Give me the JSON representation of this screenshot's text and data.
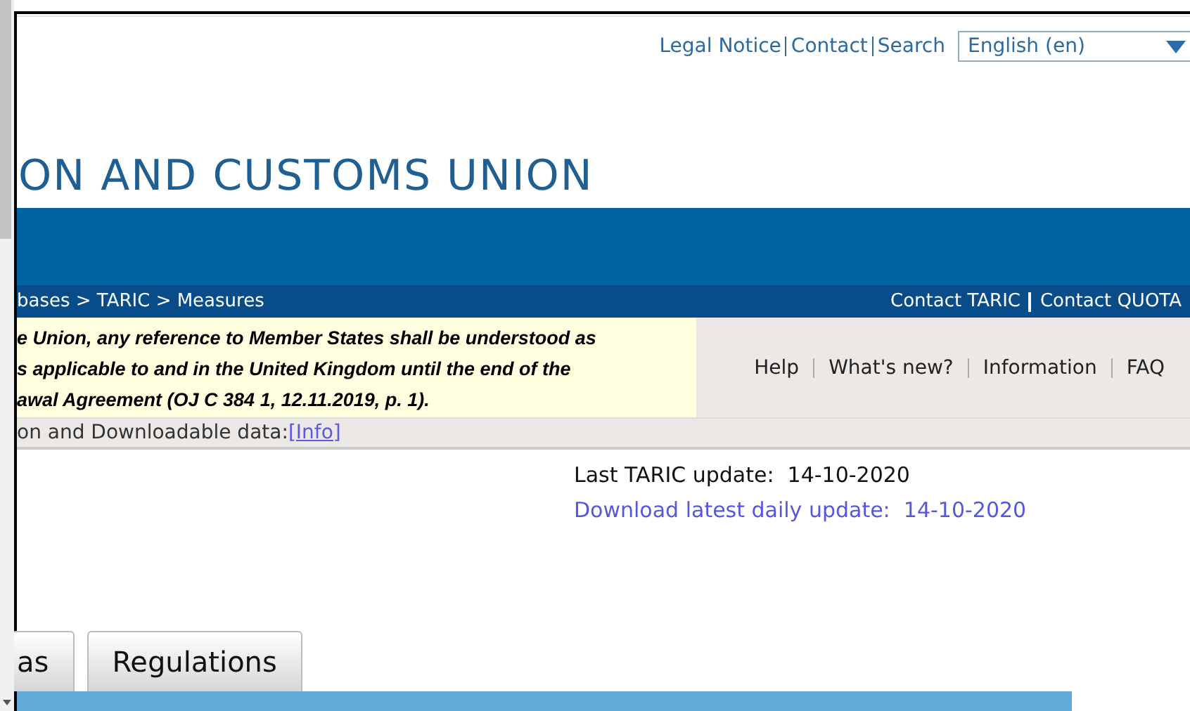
{
  "header_links": [
    {
      "label": "Legal Notice"
    },
    {
      "label": "Contact"
    },
    {
      "label": "Search"
    }
  ],
  "language_select": {
    "value": "English (en)"
  },
  "site_title": "ON AND CUSTOMS UNION",
  "breadcrumb": "bases > TARIC > Measures",
  "contact_links": [
    {
      "label": "Contact TARIC"
    },
    {
      "label": "Contact QUOTA"
    }
  ],
  "notice": [
    "e Union, any reference to Member States shall be understood as",
    "s applicable to and in the United Kingdom until the end of the",
    "awal Agreement (OJ C 384 1, 12.11.2019, p. 1)."
  ],
  "help_links": [
    {
      "label": "Help"
    },
    {
      "label": "What's new?"
    },
    {
      "label": "Information"
    },
    {
      "label": "FAQ"
    }
  ],
  "data_note": {
    "text": "on and Downloadable data:",
    "link": "[Info]"
  },
  "last_update": {
    "label": "Last TARIC update:",
    "date": "14-10-2020"
  },
  "download_link": {
    "label": "Download latest daily update:",
    "date": "14-10-2020"
  },
  "tabs": [
    {
      "label": "as",
      "selected": false
    },
    {
      "label": "Regulations",
      "selected": false
    }
  ]
}
